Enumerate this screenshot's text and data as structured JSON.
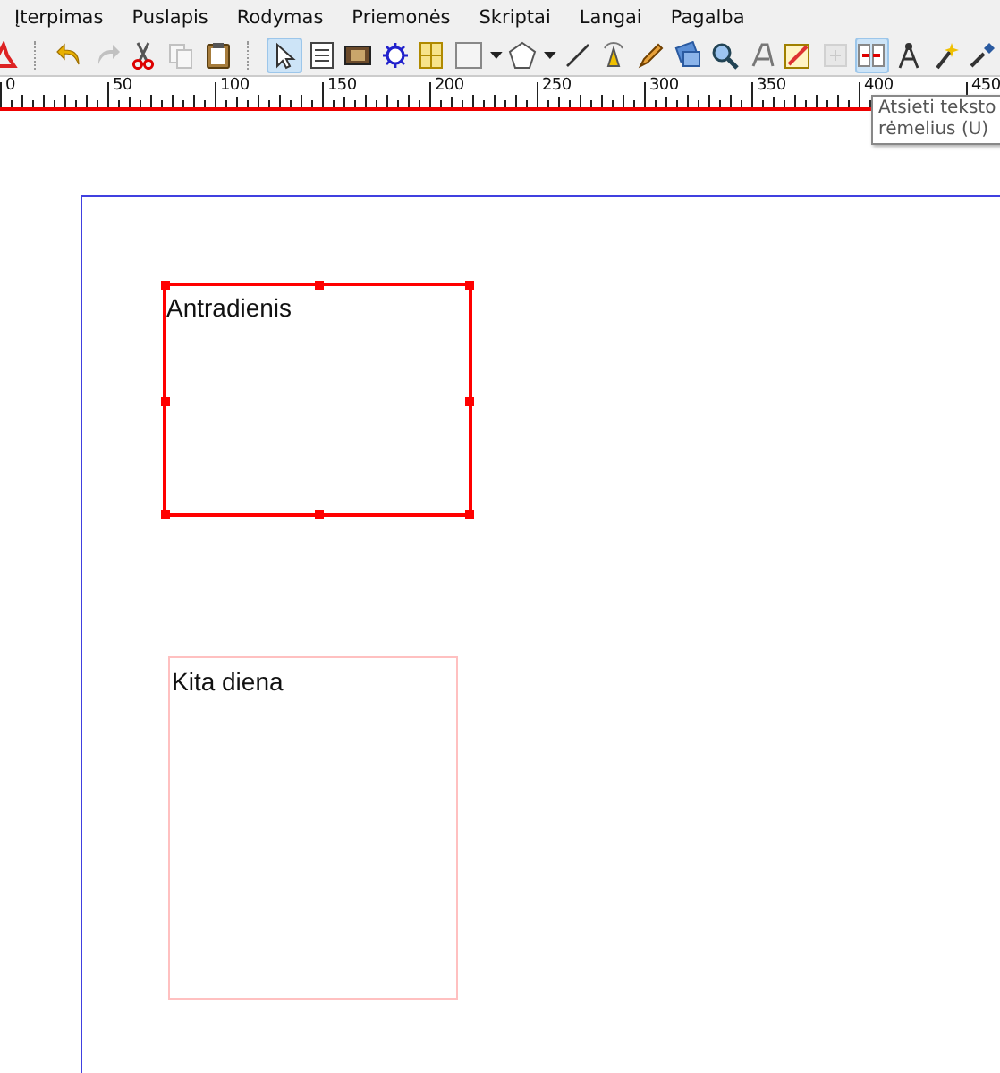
{
  "menu": [
    {
      "label": "Įterpimas"
    },
    {
      "label": "Puslapis"
    },
    {
      "label": "Rodymas"
    },
    {
      "label": "Priemonės"
    },
    {
      "label": "Skriptai"
    },
    {
      "label": "Langai"
    },
    {
      "label": "Pagalba"
    }
  ],
  "toolbar": [
    {
      "kind": "pdf",
      "selected": false,
      "disabled": false
    },
    {
      "kind": "sep"
    },
    {
      "kind": "undo",
      "selected": false,
      "disabled": false
    },
    {
      "kind": "redo",
      "selected": false,
      "disabled": true
    },
    {
      "kind": "cut",
      "selected": false,
      "disabled": false
    },
    {
      "kind": "copy",
      "selected": false,
      "disabled": true
    },
    {
      "kind": "paste",
      "selected": false,
      "disabled": false
    },
    {
      "kind": "sep"
    },
    {
      "kind": "select",
      "selected": true,
      "disabled": false
    },
    {
      "kind": "textframe",
      "selected": false,
      "disabled": false
    },
    {
      "kind": "imageframe",
      "selected": false,
      "disabled": false
    },
    {
      "kind": "render",
      "selected": false,
      "disabled": false
    },
    {
      "kind": "table",
      "selected": false,
      "disabled": false
    },
    {
      "kind": "shape",
      "selected": false,
      "disabled": false
    },
    {
      "kind": "dropdown"
    },
    {
      "kind": "polygon",
      "selected": false,
      "disabled": false
    },
    {
      "kind": "dropdown"
    },
    {
      "kind": "line",
      "selected": false,
      "disabled": false
    },
    {
      "kind": "bezier",
      "selected": false,
      "disabled": false
    },
    {
      "kind": "pencil",
      "selected": false,
      "disabled": false
    },
    {
      "kind": "rotate",
      "selected": false,
      "disabled": false
    },
    {
      "kind": "zoom",
      "selected": false,
      "disabled": false
    },
    {
      "kind": "edittext",
      "selected": false,
      "disabled": false
    },
    {
      "kind": "story",
      "selected": false,
      "disabled": false
    },
    {
      "kind": "link",
      "selected": false,
      "disabled": true
    },
    {
      "kind": "unlink",
      "selected": true,
      "disabled": false
    },
    {
      "kind": "measure",
      "selected": false,
      "disabled": false
    },
    {
      "kind": "wand",
      "selected": false,
      "disabled": false
    },
    {
      "kind": "eyedropper",
      "selected": false,
      "disabled": false
    }
  ],
  "ruler": {
    "labels": [
      "0",
      "50",
      "100",
      "150",
      "200",
      "250",
      "300",
      "350",
      "400",
      "450"
    ]
  },
  "tooltip": {
    "lines": [
      "Atsieti teksto",
      "rėmelius (U)"
    ]
  },
  "frames": [
    {
      "text": "Antradienis",
      "selected": true
    },
    {
      "text": "Kita diena",
      "selected": false
    }
  ]
}
